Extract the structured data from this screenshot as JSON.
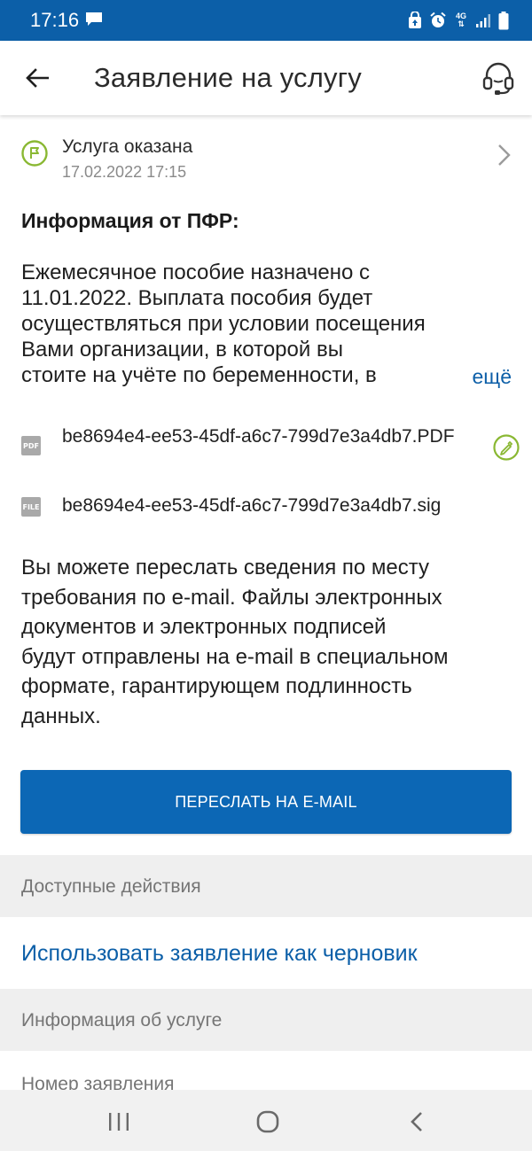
{
  "status_bar": {
    "time": "17:16",
    "network": "4G"
  },
  "header": {
    "title": "Заявление на услугу"
  },
  "service_status": {
    "title": "Услуга оказана",
    "date": "17.02.2022 17:15"
  },
  "info": {
    "heading": "Информация от ПФР:",
    "lines": [
      "Ежемесячное пособие назначено с",
      "11.01.2022. Выплата пособия будет",
      "осуществляться при условии посещения",
      "Вами организации, в которой вы",
      "стоите на учёте по беременности, в"
    ],
    "more_label": "ещё"
  },
  "files": [
    {
      "badge": "PDF",
      "name": "be8694e4-ee53-45df-a6c7-799d7e3a4db7.PDF"
    },
    {
      "badge": "FILE",
      "name": "be8694e4-ee53-45df-a6c7-799d7e3a4db7.sig"
    }
  ],
  "email_note": {
    "lines": [
      "Вы можете переслать сведения по месту",
      "требования по e-mail. Файлы электронных",
      "документов и электронных подписей",
      "будут отправлены на e-mail в специальном",
      "формате, гарантирующем подлинность",
      "данных."
    ]
  },
  "email_button": {
    "label": "ПЕРЕСЛАТЬ НА E-MAIL"
  },
  "actions": {
    "header": "Доступные действия",
    "draft_label": "Использовать заявление как черновик"
  },
  "service_info": {
    "header": "Информация об услуге",
    "number_label": "Номер заявления"
  },
  "colors": {
    "brand": "#0c5fa8",
    "accent_green": "#8ab833",
    "section_bg": "#efefef"
  },
  "icons": {
    "back": "arrow-left-icon",
    "support": "headset-icon",
    "status": "flag-icon",
    "sign": "signature-icon",
    "nav_recent": "recent-apps-icon",
    "nav_home": "home-icon",
    "nav_back": "back-icon"
  }
}
